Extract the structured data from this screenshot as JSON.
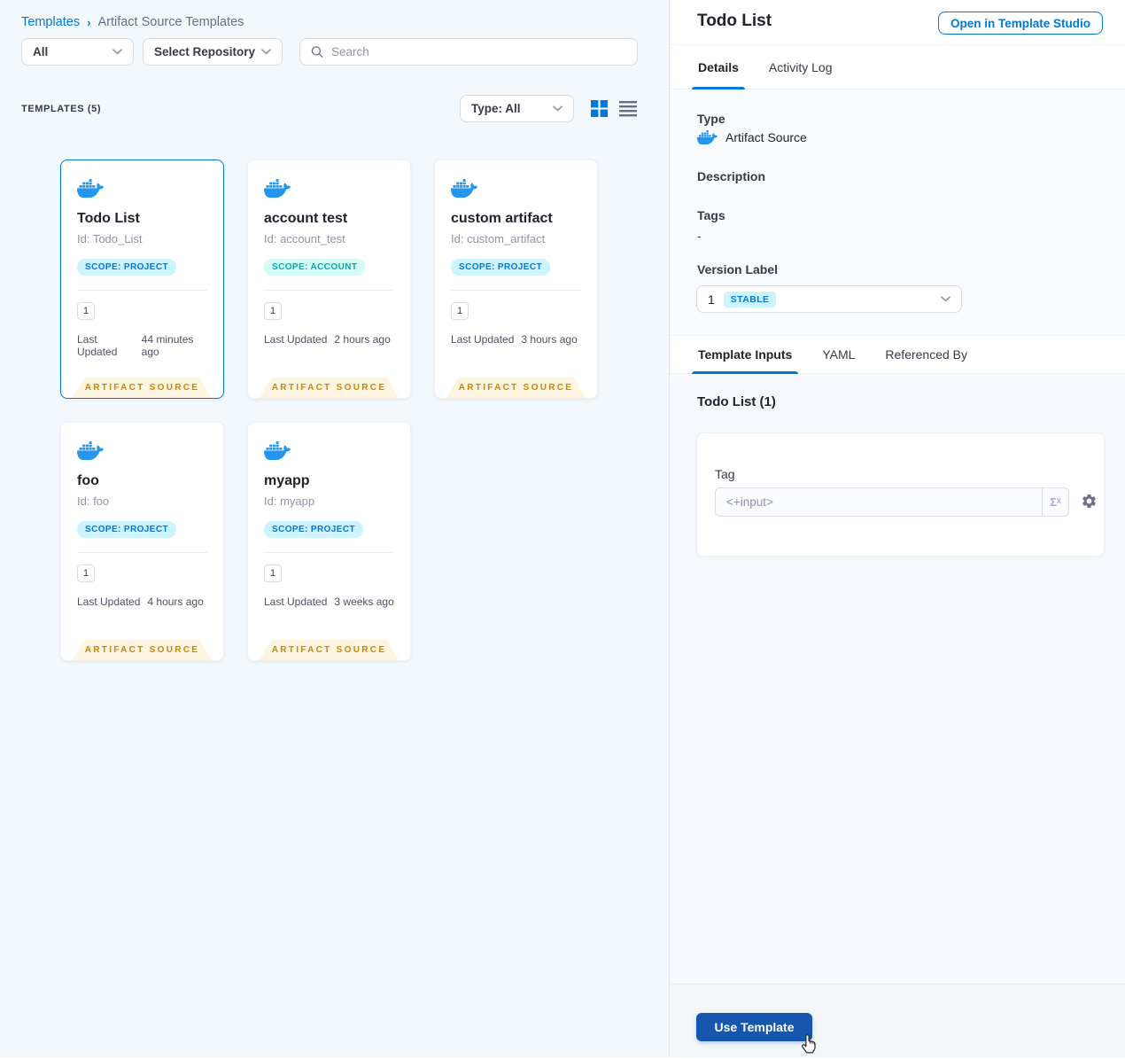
{
  "breadcrumb": {
    "root": "Templates",
    "separator": "›",
    "current": "Artifact Source Templates"
  },
  "filters": {
    "scope_filter_value": "All",
    "repository_filter_value": "Select Repository",
    "search_placeholder": "Search"
  },
  "list_header": {
    "count_label": "TEMPLATES (5)",
    "type_filter_value": "Type: All"
  },
  "cards": [
    {
      "title": "Todo List",
      "id": "Id: Todo_List",
      "scope": "SCOPE: PROJECT",
      "scope_type": "project",
      "version": "1",
      "updated_label": "Last Updated",
      "updated": "44 minutes ago",
      "ribbon": "ARTIFACT SOURCE",
      "selected": true
    },
    {
      "title": "account test",
      "id": "Id: account_test",
      "scope": "SCOPE: ACCOUNT",
      "scope_type": "account",
      "version": "1",
      "updated_label": "Last Updated",
      "updated": "2 hours ago",
      "ribbon": "ARTIFACT SOURCE",
      "selected": false
    },
    {
      "title": "custom artifact",
      "id": "Id: custom_artifact",
      "scope": "SCOPE: PROJECT",
      "scope_type": "project",
      "version": "1",
      "updated_label": "Last Updated",
      "updated": "3 hours ago",
      "ribbon": "ARTIFACT SOURCE",
      "selected": false
    },
    {
      "title": "foo",
      "id": "Id: foo",
      "scope": "SCOPE: PROJECT",
      "scope_type": "project",
      "version": "1",
      "updated_label": "Last Updated",
      "updated": "4 hours ago",
      "ribbon": "ARTIFACT SOURCE",
      "selected": false
    },
    {
      "title": "myapp",
      "id": "Id: myapp",
      "scope": "SCOPE: PROJECT",
      "scope_type": "project",
      "version": "1",
      "updated_label": "Last Updated",
      "updated": "3 weeks ago",
      "ribbon": "ARTIFACT SOURCE",
      "selected": false
    }
  ],
  "panel": {
    "title": "Todo List",
    "open_button_label": "Open in Template Studio",
    "tabs": {
      "details": "Details",
      "activity_log": "Activity Log"
    },
    "details": {
      "type_label": "Type",
      "type_value": "Artifact Source",
      "description_label": "Description",
      "tags_label": "Tags",
      "tags_value": "-",
      "version_label": "Version Label",
      "version_value": "1",
      "version_badge": "STABLE"
    },
    "sub_tabs": {
      "template_inputs": "Template Inputs",
      "yaml": "YAML",
      "referenced_by": "Referenced By"
    },
    "inputs": {
      "section_title": "Todo List (1)",
      "tag_label": "Tag",
      "tag_value": "<+input>",
      "expression_icon": "Σˣ"
    },
    "footer": {
      "use_template_label": "Use Template"
    }
  },
  "icons": {
    "docker_whale": "docker-whale",
    "search": "magnifier",
    "chevron_down": "chevron-down",
    "grid_view": "grid-squares",
    "list_view": "list-lines",
    "gear": "settings-gear",
    "cursor": "hand-pointer"
  },
  "colors": {
    "accent_blue": "#0278d5",
    "docker_blue": "#2496ed",
    "badge_project_bg": "#cdf4fe",
    "badge_project_text": "#0278d5",
    "badge_account_bg": "#d3fcf4",
    "badge_account_text": "#05aab6",
    "ribbon_bg": "#fdf5df",
    "ribbon_text": "#c7860e",
    "primary_button_bg": "#1656ad",
    "left_bg": "#f2f8fc"
  }
}
